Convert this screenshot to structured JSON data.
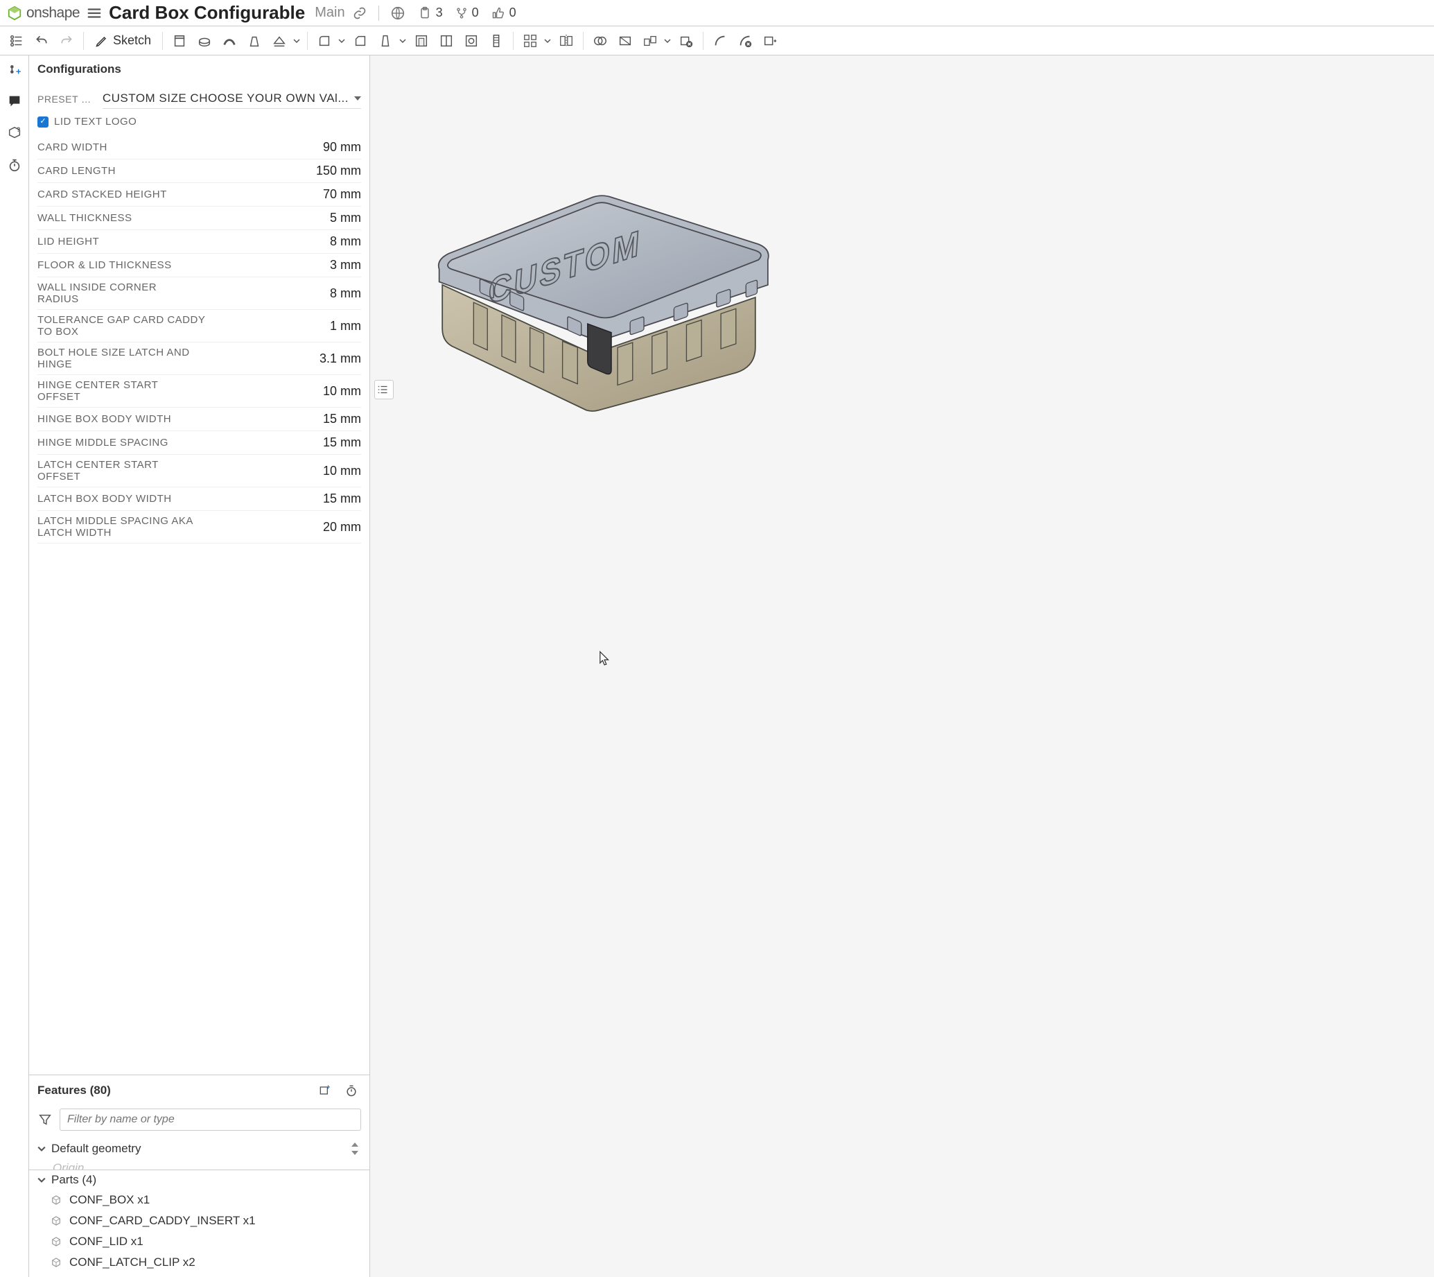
{
  "brand": {
    "name": "onshape"
  },
  "document": {
    "title": "Card Box Configurable",
    "branch": "Main"
  },
  "header_stats": {
    "copies": "3",
    "forks": "0",
    "likes": "0"
  },
  "toolbar": {
    "sketch_label": "Sketch"
  },
  "configurations": {
    "title": "Configurations",
    "preset_label": "PRESET SIZES & VARI...",
    "preset_value": "CUSTOM SIZE CHOOSE YOUR OWN VAl...",
    "lid_text_logo": {
      "label": "LID TEXT LOGO",
      "checked": true
    },
    "params": [
      {
        "label": "CARD WIDTH",
        "value": "90 mm"
      },
      {
        "label": "CARD LENGTH",
        "value": "150 mm"
      },
      {
        "label": "CARD STACKED HEIGHT",
        "value": "70 mm"
      },
      {
        "label": "WALL THICKNESS",
        "value": "5 mm"
      },
      {
        "label": "LID HEIGHT",
        "value": "8 mm"
      },
      {
        "label": "FLOOR & LID THICKNESS",
        "value": "3 mm"
      },
      {
        "label": "WALL INSIDE CORNER RADIUS",
        "value": "8 mm"
      },
      {
        "label": "TOLERANCE GAP CARD CADDY TO BOX",
        "value": "1 mm"
      },
      {
        "label": "BOLT HOLE SIZE LATCH AND HINGE",
        "value": "3.1 mm"
      },
      {
        "label": "HINGE CENTER START OFFSET",
        "value": "10 mm"
      },
      {
        "label": "HINGE BOX BODY WIDTH",
        "value": "15 mm"
      },
      {
        "label": "HINGE MIDDLE SPACING",
        "value": "15 mm"
      },
      {
        "label": "LATCH CENTER START OFFSET",
        "value": "10 mm"
      },
      {
        "label": "LATCH BOX BODY WIDTH",
        "value": "15 mm"
      },
      {
        "label": "LATCH MIDDLE SPACING AKA LATCH WIDTH",
        "value": "20 mm"
      }
    ]
  },
  "features": {
    "title": "Features (80)",
    "filter_placeholder": "Filter by name or type",
    "default_geometry": "Default geometry",
    "origin": "Origin"
  },
  "parts": {
    "title": "Parts (4)",
    "items": [
      "CONF_BOX x1",
      "CONF_CARD_CADDY_INSERT x1",
      "CONF_LID x1",
      "CONF_LATCH_CLIP x2"
    ]
  },
  "viewport": {
    "lid_text": "CUSTOM"
  }
}
